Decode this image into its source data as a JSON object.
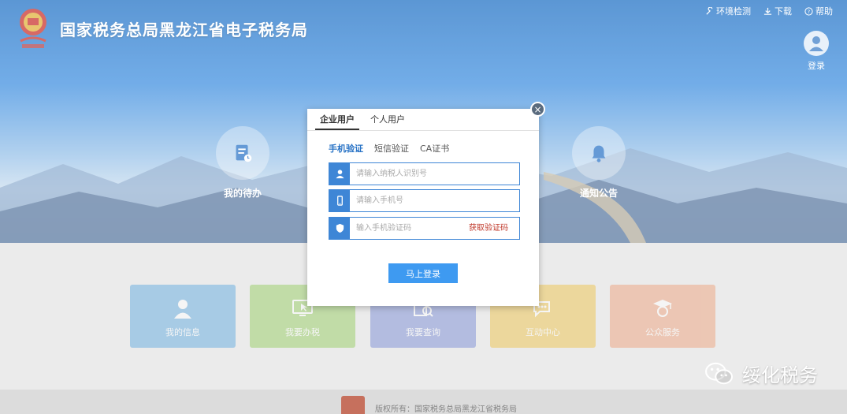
{
  "header": {
    "title": "国家税务总局黑龙江省电子税务局",
    "links": [
      "环境检测",
      "下载",
      "帮助"
    ],
    "login_label": "登录"
  },
  "hero": {
    "items": [
      {
        "label": "我的待办",
        "icon": "document-clock-icon"
      },
      {
        "label": "通知公告",
        "icon": "bell-icon"
      }
    ]
  },
  "tiles": [
    {
      "label": "我的信息",
      "color": "#3b95d6",
      "icon": "user-icon"
    },
    {
      "label": "我要办税",
      "color": "#7bc03a",
      "icon": "monitor-cursor-icon"
    },
    {
      "label": "我要查询",
      "color": "#5870c8",
      "icon": "search-document-icon"
    },
    {
      "label": "互动中心",
      "color": "#e8b21f",
      "icon": "chat-icon"
    },
    {
      "label": "公众服务",
      "color": "#e88a5a",
      "icon": "graduate-icon"
    }
  ],
  "modal": {
    "tabs": [
      "企业用户",
      "个人用户"
    ],
    "active_tab": 0,
    "subtabs": [
      "手机验证",
      "短信验证",
      "CA证书"
    ],
    "active_subtab": 0,
    "fields": {
      "taxpayer_id_placeholder": "请输入纳税人识别号",
      "phone_placeholder": "请输入手机号",
      "code_placeholder": "输入手机验证码"
    },
    "get_code_label": "获取验证码",
    "submit_label": "马上登录",
    "close_symbol": "×"
  },
  "footer": {
    "copyright": "版权所有：国家税务总局黑龙江省税务局"
  },
  "watermark": {
    "text": "绥化税务"
  }
}
